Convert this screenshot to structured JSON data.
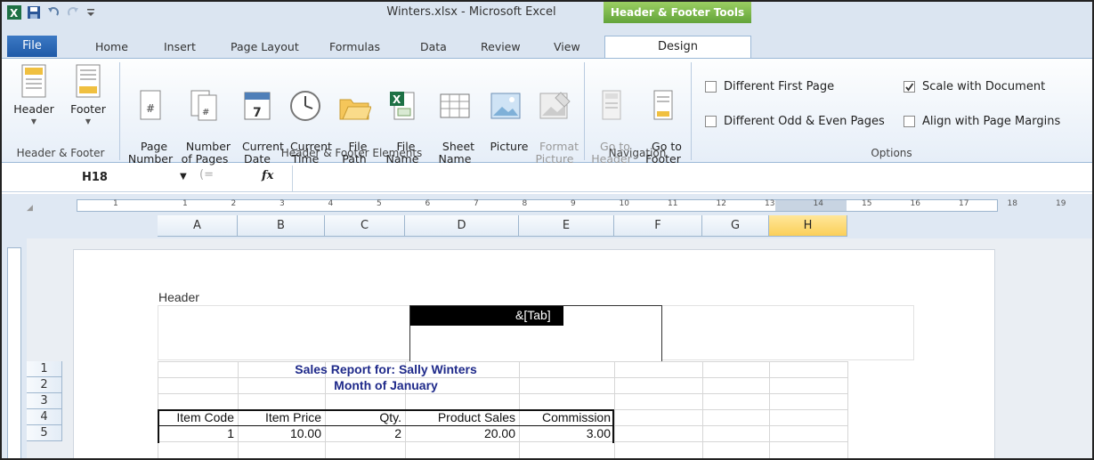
{
  "window": {
    "title": "Winters.xlsx - Microsoft Excel",
    "context_tab_title": "Header & Footer Tools"
  },
  "tabs": [
    "File",
    "Home",
    "Insert",
    "Page Layout",
    "Formulas",
    "Data",
    "Review",
    "View",
    "Design"
  ],
  "ribbon": {
    "groups": [
      {
        "label": "Header & Footer",
        "buttons": [
          {
            "label": "Header"
          },
          {
            "label": "Footer"
          }
        ]
      },
      {
        "label": "Header & Footer Elements",
        "buttons": [
          {
            "label": "Page\nNumber"
          },
          {
            "label": "Number\nof Pages"
          },
          {
            "label": "Current\nDate"
          },
          {
            "label": "Current\nTime"
          },
          {
            "label": "File\nPath"
          },
          {
            "label": "File\nName"
          },
          {
            "label": "Sheet\nName"
          },
          {
            "label": "Picture"
          },
          {
            "label": "Format\nPicture"
          }
        ]
      },
      {
        "label": "Navigation",
        "buttons": [
          {
            "label": "Go to\nHeader"
          },
          {
            "label": "Go to\nFooter"
          }
        ]
      },
      {
        "label": "Options"
      }
    ],
    "options": [
      {
        "label": "Different First Page",
        "checked": false
      },
      {
        "label": "Scale with Document",
        "checked": true
      },
      {
        "label": "Different Odd & Even Pages",
        "checked": false
      },
      {
        "label": "Align with Page Margins",
        "checked": false
      }
    ]
  },
  "formula_bar": {
    "name_box": "H18",
    "fx": "fx",
    "value": ""
  },
  "ruler_numbers": [
    "1",
    "1",
    "2",
    "3",
    "4",
    "5",
    "6",
    "7",
    "8",
    "9",
    "10",
    "11",
    "12",
    "13",
    "14",
    "15",
    "16",
    "17",
    "18",
    "19"
  ],
  "columns": [
    "A",
    "B",
    "C",
    "D",
    "E",
    "F",
    "G",
    "H"
  ],
  "selected_column": "H",
  "rows": [
    "1",
    "2",
    "3",
    "4",
    "5"
  ],
  "header_label": "Header",
  "header_center_code": "&[Tab]",
  "sheet": {
    "title_row1": "Sales Report for: Sally Winters",
    "title_row2": "Month of January",
    "col_headers": [
      "Item Code",
      "Item Price",
      "Qty.",
      "Product Sales",
      "Commission"
    ],
    "row5": [
      "1",
      "10.00",
      "2",
      "20.00",
      "3.00"
    ]
  }
}
